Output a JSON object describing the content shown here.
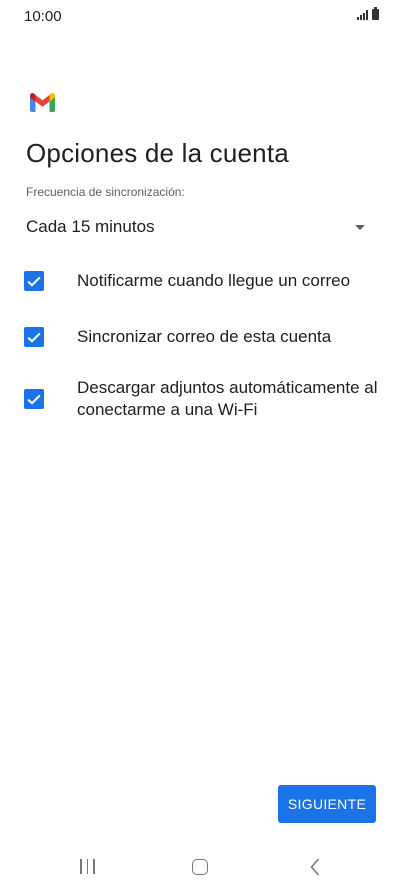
{
  "status_bar": {
    "time": "10:00"
  },
  "header": {
    "logo_icon": "gmail-logo-icon",
    "title": "Opciones de la cuenta"
  },
  "sync_frequency": {
    "label": "Frecuencia de sincronización:",
    "value": "Cada 15 minutos"
  },
  "options": [
    {
      "label": "Notificarme cuando llegue un correo",
      "checked": true
    },
    {
      "label": "Sincronizar correo de esta cuenta",
      "checked": true
    },
    {
      "label": "Descargar adjuntos automáticamente al conectarme a una Wi-Fi",
      "checked": true
    }
  ],
  "actions": {
    "next_label": "SIGUIENTE"
  },
  "colors": {
    "accent": "#1a73e8",
    "text_primary": "#202124",
    "text_secondary": "#5f6368"
  }
}
